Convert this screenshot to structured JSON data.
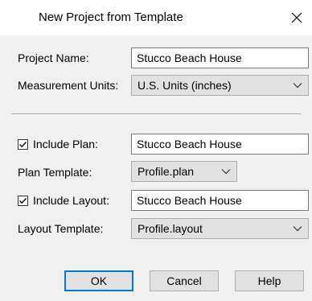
{
  "window": {
    "title": "New Project from Template",
    "close_glyph": "close-icon"
  },
  "form": {
    "project_name_label": "Project Name:",
    "project_name_value": "Stucco Beach House",
    "units_label": "Measurement Units:",
    "units_value": "U.S. Units (inches)",
    "include_plan_label": "Include Plan:",
    "include_plan_checked": true,
    "plan_name_value": "Stucco Beach House",
    "plan_template_label": "Plan Template:",
    "plan_template_value": "Profile.plan",
    "include_layout_label": "Include Layout:",
    "include_layout_checked": true,
    "layout_name_value": "Stucco Beach House",
    "layout_template_label": "Layout Template:",
    "layout_template_value": "Profile.layout"
  },
  "buttons": {
    "ok": "OK",
    "cancel": "Cancel",
    "help": "Help"
  },
  "colors": {
    "dialog_bg": "#f0f0f0",
    "titlebar_bg": "#ffffff",
    "default_button_border": "#0078d7"
  }
}
